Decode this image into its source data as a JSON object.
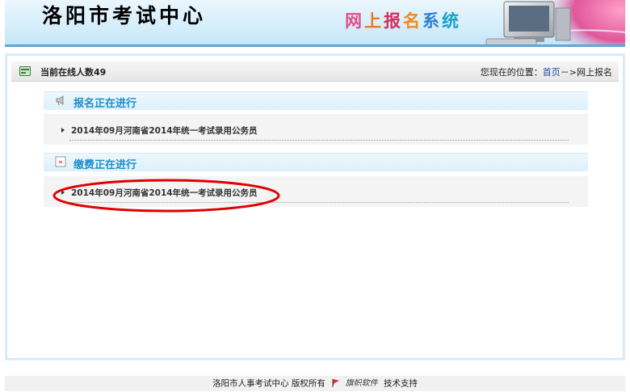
{
  "header": {
    "center_name": "洛阳市考试中心",
    "system_chars": [
      "网",
      "上",
      "报",
      "名",
      "系",
      "统"
    ]
  },
  "topbar": {
    "online_label": "当前在线人数49",
    "location_prefix": "您现在的位置：",
    "location_home": "首页",
    "location_sep": "－>",
    "location_current": "网上报名"
  },
  "sections": [
    {
      "title": "报名正在进行",
      "items": [
        {
          "label": "2014年09月河南省2014年统一考试录用公务员"
        }
      ]
    },
    {
      "title": "缴费正在进行",
      "items": [
        {
          "label": "2014年09月河南省2014年统一考试录用公务员"
        }
      ]
    }
  ],
  "footer": {
    "copyright": "洛阳市人事考试中心  版权所有",
    "logo_text": "旗帜软件",
    "support": "技术支持"
  },
  "colors": {
    "section_title": "#1e8dc8",
    "highlight": "#e00000",
    "banner_line": "#5aa7d9"
  }
}
